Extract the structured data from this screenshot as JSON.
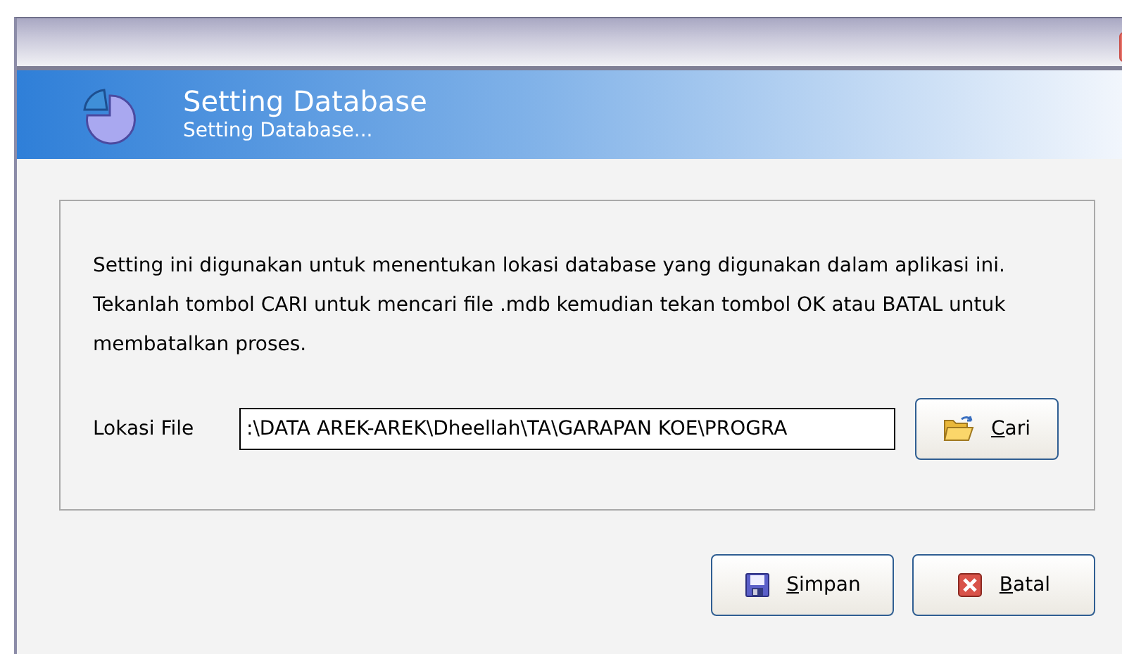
{
  "header": {
    "title": "Setting Database",
    "subtitle": "Setting Database..."
  },
  "description": "Setting ini digunakan untuk menentukan lokasi database yang digunakan dalam aplikasi ini. Tekanlah tombol CARI untuk mencari file .mdb kemudian tekan tombol OK atau BATAL untuk membatalkan proses.",
  "file_field": {
    "label": "Lokasi File",
    "value": ":\\DATA AREK-AREK\\Dheellah\\TA\\GARAPAN KOE\\PROGRA"
  },
  "buttons": [
    {
      "kind": "browse",
      "label": "Cari"
    },
    {
      "kind": "save",
      "label": "Simpan"
    },
    {
      "kind": "cancel",
      "label": "Batal"
    }
  ]
}
